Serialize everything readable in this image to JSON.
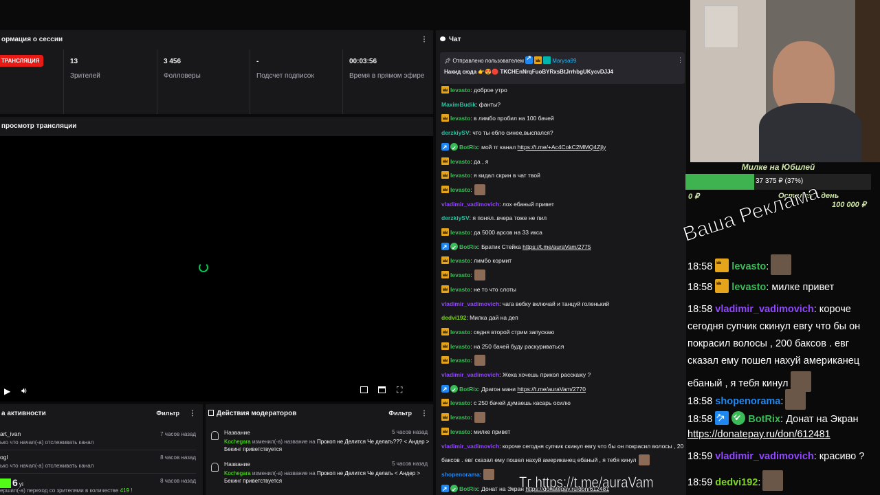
{
  "session": {
    "title": "ормация о сессии",
    "live_badge": "ТРАНСЛЯЦИЯ",
    "stats": [
      {
        "value": "13",
        "label": "Зрителей"
      },
      {
        "value": "3 456",
        "label": "Фолловеры"
      },
      {
        "value": "-",
        "label": "Подсчет подписок"
      },
      {
        "value": "00:03:56",
        "label": "Время в прямом эфире"
      }
    ]
  },
  "preview": {
    "title": "просмотр трансляции"
  },
  "activity": {
    "title": "а активности",
    "filter": "Фильтр",
    "items": [
      {
        "name": "art_ivan",
        "time": "7 часов назад",
        "text": "ько что начал(-а) отслеживать канал"
      },
      {
        "name": "ogl",
        "time": "8 часов назад",
        "text": "ько что начал(-а) отслеживать канал"
      },
      {
        "name": "yi",
        "time": "8 часов назад",
        "text": "ершил(-а) переход со зрителями в количестве",
        "count": "419",
        "tail": "!"
      }
    ]
  },
  "modactions": {
    "title": "Действия модераторов",
    "filter": "Фильтр",
    "items": [
      {
        "label": "Название",
        "time": "5 часов назад",
        "user": "Kochegara",
        "action": " изменил(-а) название на ",
        "value": "Прокоп не Делится Че делать??? < Андер >",
        "line2": "Бекинг приветствуется"
      },
      {
        "label": "Название",
        "time": "5 часов назад",
        "user": "Kochegara",
        "action": " изменил(-а) название на ",
        "value": "Прокоп не Делится Че делать < Андер >",
        "line2": "Бекинг приветствуется"
      }
    ]
  },
  "chat": {
    "title": "Чат",
    "pinned_by": "Отправлено пользователем",
    "pinned_user": "Marysa99",
    "pinned_text_prefix": "Накид сюда",
    "pinned_text": "TKCHEnNrqFuoBYRxsBtJrrhbgUKycvDJJ4",
    "messages": [
      {
        "user": "levasto",
        "color": "#3bbb57",
        "badges": [
          "crown"
        ],
        "text": ": доброе утро"
      },
      {
        "user": "MaximBudik",
        "color": "#2bc0a0",
        "badges": [],
        "text": ": фанты?"
      },
      {
        "user": "levasto",
        "color": "#3bbb57",
        "badges": [
          "crown"
        ],
        "text": ": в лимбо пробил на 100 бачей"
      },
      {
        "user": "derzkiySV",
        "color": "#2bc0a0",
        "badges": [],
        "text": ": что ты ебло синее,выспался?"
      },
      {
        "user": "BotRix",
        "color": "#3bbb57",
        "badges": [
          "vrf",
          "chk"
        ],
        "text": ": мой тг канал ",
        "link": "https://t.me/+Ac4CokC2MMQ4Zjly"
      },
      {
        "user": "levasto",
        "color": "#3bbb57",
        "badges": [
          "crown"
        ],
        "text": ": да , я"
      },
      {
        "user": "levasto",
        "color": "#3bbb57",
        "badges": [
          "crown"
        ],
        "text": ": я кидал скрин в чат твой"
      },
      {
        "user": "levasto",
        "color": "#3bbb57",
        "badges": [
          "crown"
        ],
        "text": ":",
        "emote": true
      },
      {
        "user": "vladimir_vadimovich",
        "color": "#9146ff",
        "badges": [],
        "text": ": лох ебаный привет"
      },
      {
        "user": "derzkiySV",
        "color": "#2bc0a0",
        "badges": [],
        "text": ": я понял..вчера тоже не пил"
      },
      {
        "user": "levasto",
        "color": "#3bbb57",
        "badges": [
          "crown"
        ],
        "text": ": да 5000 арсов на 33 икса"
      },
      {
        "user": "BotRix",
        "color": "#3bbb57",
        "badges": [
          "vrf",
          "chk"
        ],
        "text": ": Братик Стейка ",
        "link": "https://t.me/auraVam/2775"
      },
      {
        "user": "levasto",
        "color": "#3bbb57",
        "badges": [
          "crown"
        ],
        "text": ": лимбо кормит"
      },
      {
        "user": "levasto",
        "color": "#3bbb57",
        "badges": [
          "crown"
        ],
        "text": ":",
        "emote": true
      },
      {
        "user": "levasto",
        "color": "#3bbb57",
        "badges": [
          "crown"
        ],
        "text": ": не то что слоты"
      },
      {
        "user": "vladimir_vadimovich",
        "color": "#9146ff",
        "badges": [],
        "text": ": чага вебку включай и танцуй голенький"
      },
      {
        "user": "dedvi192",
        "color": "#7ed321",
        "badges": [],
        "text": ": Милка дай на деп"
      },
      {
        "user": "levasto",
        "color": "#3bbb57",
        "badges": [
          "crown"
        ],
        "text": ": седня второй стрим запускаю"
      },
      {
        "user": "levasto",
        "color": "#3bbb57",
        "badges": [
          "crown"
        ],
        "text": ": на 250 бачей буду раскуриваться"
      },
      {
        "user": "levasto",
        "color": "#3bbb57",
        "badges": [
          "crown"
        ],
        "text": ":",
        "emote": true
      },
      {
        "user": "vladimir_vadimovich",
        "color": "#9146ff",
        "badges": [],
        "text": ": Жека хочешь прикол расскажу ?"
      },
      {
        "user": "BotRix",
        "color": "#3bbb57",
        "badges": [
          "vrf",
          "chk"
        ],
        "text": ": Драгон мани ",
        "link": "https://t.me/auraVam/2770"
      },
      {
        "user": "levasto",
        "color": "#3bbb57",
        "badges": [
          "crown"
        ],
        "text": ": с 250 бачей думаешь касарь осилю"
      },
      {
        "user": "levasto",
        "color": "#3bbb57",
        "badges": [
          "crown"
        ],
        "text": ":",
        "emote": true
      },
      {
        "user": "levasto",
        "color": "#3bbb57",
        "badges": [
          "crown"
        ],
        "text": ": милке привет"
      },
      {
        "user": "vladimir_vadimovich",
        "color": "#9146ff",
        "badges": [],
        "text": ": короче сегодня супчик скинул евгу что бы он покрасил волосы , 20"
      },
      {
        "user": "",
        "color": "#efeff1",
        "badges": [],
        "text": "баксов . евг сказал ему пошел нахуй американец ебаный , я тебя кинул",
        "emote": true
      },
      {
        "user": "shopenorama",
        "color": "#1f87f2",
        "badges": [],
        "text": ":",
        "emote": true
      },
      {
        "user": "BotRix",
        "color": "#3bbb57",
        "badges": [
          "vrf",
          "chk"
        ],
        "text": ": Донат на Экран ",
        "link": "https://donatepay.ru/don/612481"
      }
    ]
  },
  "goal": {
    "title": "Милке на Юбилей",
    "progress_text": "37 375 ₽ (37%)",
    "progress": 0.37,
    "min": "0 ₽",
    "remaining": "Остался 1 день",
    "max": "100 000 ₽"
  },
  "ad_text": "Ваша Реклама",
  "overlay_chat": [
    {
      "time": "18:58",
      "badges": [
        "crown"
      ],
      "user": "levasto",
      "color": "#3bbb57",
      "text": ":",
      "emote": true
    },
    {
      "time": "18:58",
      "badges": [
        "crown"
      ],
      "user": "levasto",
      "color": "#3bbb57",
      "text": ": милке привет"
    },
    {
      "time": "18:58",
      "badges": [],
      "user": "vladimir_vadimovich",
      "color": "#9146ff",
      "text": ": короче"
    },
    {
      "time": "",
      "badges": [],
      "user": "",
      "color": "#fff",
      "text": "сегодня супчик скинул евгу что бы он"
    },
    {
      "time": "",
      "badges": [],
      "user": "",
      "color": "#fff",
      "text": "покрасил волосы , 200 баксов . евг"
    },
    {
      "time": "",
      "badges": [],
      "user": "",
      "color": "#fff",
      "text": "сказал ему пошел нахуй американец"
    },
    {
      "time": "",
      "badges": [],
      "user": "",
      "color": "#fff",
      "text": "ебаный , я тебя кинул",
      "emote": true
    },
    {
      "time": "18:58",
      "badges": [],
      "user": "shopenorama",
      "color": "#1f87f2",
      "text": ":",
      "emote": true
    },
    {
      "time": "18:58",
      "badges": [
        "vrf",
        "chk"
      ],
      "user": "BotRix",
      "color": "#3bbb57",
      "text": ": Донат на Экран"
    },
    {
      "time": "",
      "badges": [],
      "user": "",
      "color": "#fff",
      "text": "https://donatepay.ru/don/612481",
      "link": true
    },
    {
      "time": "18:59",
      "badges": [],
      "user": "vladimir_vadimovich",
      "color": "#9146ff",
      "text": ": красиво ?"
    },
    {
      "time": "18:59",
      "badges": [],
      "user": "dedvi192",
      "color": "#7ed321",
      "text": ":",
      "emote": true
    }
  ],
  "tg_overlay": "Тг https://t.me/auraVam",
  "bottom_logo": "6"
}
